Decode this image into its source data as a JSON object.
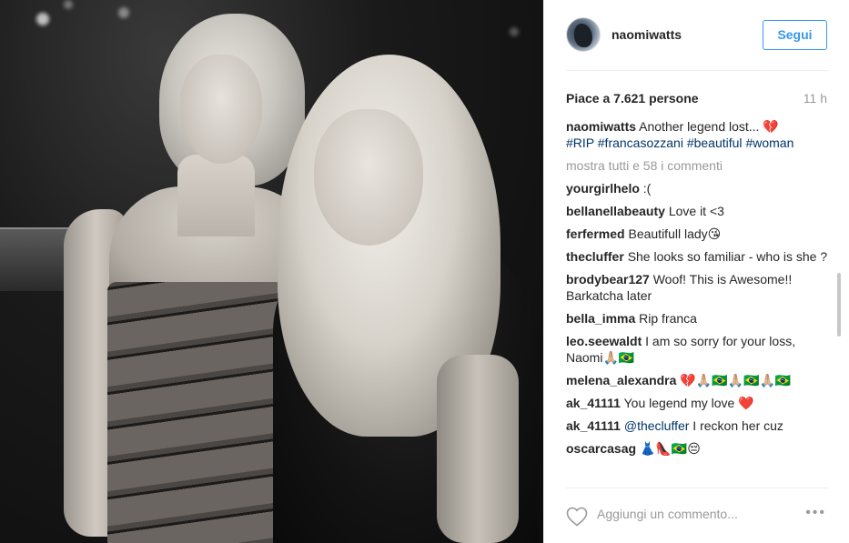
{
  "post": {
    "username": "naomiwatts",
    "follow_label": "Segui",
    "likes": "Piace a 7.621 persone",
    "time": "11 h",
    "caption": {
      "user": "naomiwatts",
      "text": "Another legend lost... 💔",
      "tags": [
        "#RIP",
        "#francasozzani",
        "#beautiful",
        "#woman"
      ]
    },
    "load_more": "mostra tutti e 58 i commenti",
    "comments": [
      {
        "user": "yourgirlhelo",
        "text": ":("
      },
      {
        "user": "bellanellabeauty",
        "text": "Love it <3"
      },
      {
        "user": "ferfermed",
        "text": "Beautifull lady😘"
      },
      {
        "user": "thecluffer",
        "text": "She looks so familiar - who is she ?"
      },
      {
        "user": "brodybear127",
        "text": "Woof! This is Awesome!! Barkatcha later"
      },
      {
        "user": "bella_imma",
        "text": "Rip franca"
      },
      {
        "user": "leo.seewaldt",
        "text": "I am so sorry for your loss, Naomi🙏🏼🇧🇷"
      },
      {
        "user": "melena_alexandra",
        "text": "💔🙏🏼🇧🇷🙏🏼🇧🇷🙏🏼🇧🇷"
      },
      {
        "user": "ak_41111",
        "text": "You legend my love ❤️"
      },
      {
        "user": "ak_41111",
        "mention": "@thecluffer",
        "text": " I reckon her cuz"
      },
      {
        "user": "oscarcasag",
        "text": "👗👠🇧🇷😔"
      }
    ],
    "add_comment_placeholder": "Aggiungi un commento...",
    "more_icon": "•••"
  },
  "icons": {
    "heart": "heart-icon",
    "more": "more-options-icon"
  }
}
